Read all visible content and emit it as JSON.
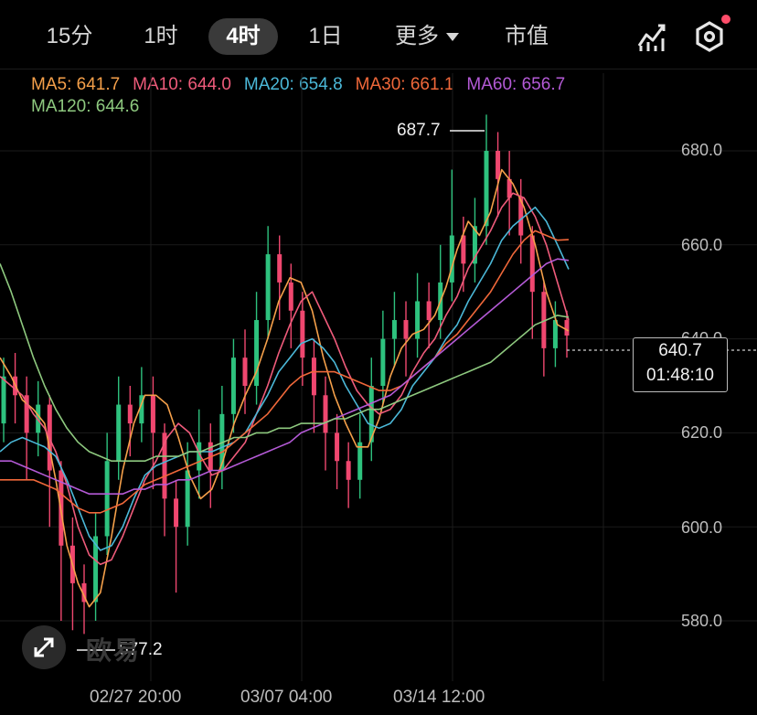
{
  "tabs": [
    {
      "label": "15分"
    },
    {
      "label": "1时"
    },
    {
      "label": "4时"
    },
    {
      "label": "1日"
    },
    {
      "label": "更多"
    },
    {
      "label": "市值"
    }
  ],
  "active_tab": "4时",
  "ma_indicators": [
    {
      "label": "MA5: 641.7",
      "color": "#f5a04a"
    },
    {
      "label": "MA10: 644.0",
      "color": "#ef5b7b"
    },
    {
      "label": "MA20: 654.8",
      "color": "#4bb8d8"
    },
    {
      "label": "MA30: 661.1",
      "color": "#f0683a"
    },
    {
      "label": "MA60: 656.7",
      "color": "#b45ad6"
    },
    {
      "label": "MA120: 644.6",
      "color": "#8ec97f"
    }
  ],
  "current_price": {
    "price": "640.7",
    "countdown": "01:48:10",
    "value": 640.7
  },
  "high_marker": {
    "label": "687.7",
    "value": 687.7
  },
  "low_marker": {
    "label": "577.2",
    "value": 577.2
  },
  "watermark": "欧易",
  "colors": {
    "up": "#2ec27e",
    "down": "#ef476f",
    "grid": "#1b1b1b"
  },
  "chart_data": {
    "type": "candlestick",
    "ylim": [
      570,
      692
    ],
    "y_ticks": [
      580.0,
      600.0,
      620.0,
      640.0,
      660.0,
      680.0
    ],
    "y_tick_labels": [
      "580.0",
      "600.0",
      "620.0",
      "640.0",
      "660.0",
      "680.0"
    ],
    "x_tick_labels": [
      "02/27 20:00",
      "03/07 04:00",
      "03/14 12:00"
    ],
    "series": [
      {
        "name": "MA5",
        "values": [
          636,
          632,
          627,
          625,
          622,
          610,
          596,
          588,
          583,
          586,
          598,
          612,
          622,
          628,
          628,
          626,
          619,
          611,
          606,
          608,
          614,
          622,
          628,
          633,
          640,
          648,
          653,
          652,
          646,
          636,
          628,
          622,
          617,
          617,
          623,
          632,
          638,
          641,
          642,
          645,
          651,
          659,
          665,
          662,
          667,
          676,
          673,
          668,
          660,
          650,
          643,
          641.7
        ]
      },
      {
        "name": "MA10",
        "values": [
          632,
          630,
          628,
          624,
          621,
          616,
          609,
          600,
          594,
          592,
          593,
          598,
          604,
          610,
          614,
          619,
          622,
          620,
          615,
          611,
          612,
          615,
          618,
          624,
          630,
          637,
          643,
          648,
          650,
          645,
          640,
          634,
          629,
          626,
          624,
          625,
          628,
          633,
          637,
          640,
          645,
          649,
          655,
          659,
          663,
          668,
          671,
          670,
          666,
          660,
          652,
          644.0
        ]
      },
      {
        "name": "MA20",
        "values": [
          616,
          618,
          619,
          618,
          617,
          615,
          610,
          604,
          598,
          595,
          596,
          600,
          606,
          611,
          613,
          614,
          615,
          616,
          616,
          616,
          617,
          618,
          620,
          624,
          628,
          633,
          636,
          639,
          640,
          638,
          635,
          630,
          626,
          622,
          621,
          622,
          625,
          630,
          633,
          636,
          640,
          643,
          648,
          652,
          656,
          661,
          664,
          666,
          668,
          665,
          660,
          654.8
        ]
      },
      {
        "name": "MA30",
        "values": [
          610,
          610,
          610,
          610,
          609,
          608,
          606,
          604,
          603,
          603,
          604,
          605,
          607,
          609,
          610,
          611,
          612,
          613,
          614,
          615,
          616,
          618,
          620,
          622,
          624,
          627,
          630,
          632,
          633,
          633,
          633,
          632,
          631,
          630,
          629,
          629,
          630,
          632,
          634,
          636,
          639,
          641,
          644,
          647,
          650,
          654,
          658,
          661,
          663,
          662,
          661,
          661.1
        ]
      },
      {
        "name": "MA60",
        "values": [
          614,
          614,
          613,
          612,
          611,
          610,
          609,
          608,
          607,
          607,
          607,
          607,
          608,
          608,
          609,
          609,
          610,
          610,
          611,
          612,
          612,
          613,
          614,
          615,
          616,
          617,
          618,
          620,
          621,
          622,
          623,
          624,
          625,
          626,
          627,
          628,
          630,
          632,
          634,
          636,
          638,
          640,
          642,
          644,
          646,
          648,
          650,
          652,
          654,
          656,
          657,
          656.7
        ]
      },
      {
        "name": "MA120",
        "values": [
          656,
          650,
          643,
          636,
          630,
          625,
          621,
          618,
          616,
          615,
          614,
          614,
          614,
          614,
          615,
          615,
          615,
          616,
          616,
          617,
          618,
          619,
          619,
          620,
          620,
          621,
          621,
          622,
          622,
          622,
          623,
          623,
          624,
          625,
          625,
          626,
          627,
          628,
          629,
          630,
          631,
          632,
          633,
          634,
          635,
          637,
          639,
          641,
          643,
          644,
          645,
          644.6
        ]
      }
    ],
    "candles": [
      {
        "o": 622,
        "c": 632,
        "h": 636,
        "l": 618
      },
      {
        "o": 632,
        "c": 628,
        "h": 637,
        "l": 622
      },
      {
        "o": 628,
        "c": 620,
        "h": 632,
        "l": 610
      },
      {
        "o": 620,
        "c": 626,
        "h": 631,
        "l": 615
      },
      {
        "o": 626,
        "c": 612,
        "h": 628,
        "l": 600
      },
      {
        "o": 612,
        "c": 596,
        "h": 614,
        "l": 580
      },
      {
        "o": 596,
        "c": 588,
        "h": 602,
        "l": 578
      },
      {
        "o": 588,
        "c": 584,
        "h": 592,
        "l": 577.2
      },
      {
        "o": 584,
        "c": 598,
        "h": 603,
        "l": 580
      },
      {
        "o": 598,
        "c": 614,
        "h": 620,
        "l": 594
      },
      {
        "o": 614,
        "c": 626,
        "h": 632,
        "l": 610
      },
      {
        "o": 626,
        "c": 622,
        "h": 630,
        "l": 615
      },
      {
        "o": 622,
        "c": 628,
        "h": 634,
        "l": 618
      },
      {
        "o": 628,
        "c": 620,
        "h": 632,
        "l": 608
      },
      {
        "o": 620,
        "c": 606,
        "h": 622,
        "l": 598
      },
      {
        "o": 606,
        "c": 600,
        "h": 610,
        "l": 586
      },
      {
        "o": 600,
        "c": 612,
        "h": 618,
        "l": 596
      },
      {
        "o": 612,
        "c": 618,
        "h": 625,
        "l": 606
      },
      {
        "o": 618,
        "c": 612,
        "h": 622,
        "l": 604
      },
      {
        "o": 612,
        "c": 624,
        "h": 630,
        "l": 608
      },
      {
        "o": 624,
        "c": 636,
        "h": 640,
        "l": 620
      },
      {
        "o": 636,
        "c": 630,
        "h": 642,
        "l": 624
      },
      {
        "o": 630,
        "c": 644,
        "h": 650,
        "l": 626
      },
      {
        "o": 644,
        "c": 658,
        "h": 664,
        "l": 640
      },
      {
        "o": 658,
        "c": 652,
        "h": 662,
        "l": 644
      },
      {
        "o": 652,
        "c": 646,
        "h": 656,
        "l": 638
      },
      {
        "o": 646,
        "c": 636,
        "h": 650,
        "l": 630
      },
      {
        "o": 636,
        "c": 628,
        "h": 640,
        "l": 620
      },
      {
        "o": 628,
        "c": 620,
        "h": 632,
        "l": 612
      },
      {
        "o": 620,
        "c": 614,
        "h": 624,
        "l": 608
      },
      {
        "o": 614,
        "c": 610,
        "h": 618,
        "l": 604
      },
      {
        "o": 610,
        "c": 618,
        "h": 624,
        "l": 606
      },
      {
        "o": 618,
        "c": 630,
        "h": 636,
        "l": 614
      },
      {
        "o": 630,
        "c": 640,
        "h": 646,
        "l": 626
      },
      {
        "o": 640,
        "c": 644,
        "h": 650,
        "l": 634
      },
      {
        "o": 644,
        "c": 640,
        "h": 648,
        "l": 632
      },
      {
        "o": 640,
        "c": 648,
        "h": 654,
        "l": 636
      },
      {
        "o": 648,
        "c": 644,
        "h": 652,
        "l": 638
      },
      {
        "o": 644,
        "c": 652,
        "h": 660,
        "l": 640
      },
      {
        "o": 652,
        "c": 662,
        "h": 676,
        "l": 648
      },
      {
        "o": 662,
        "c": 656,
        "h": 666,
        "l": 650
      },
      {
        "o": 656,
        "c": 664,
        "h": 670,
        "l": 652
      },
      {
        "o": 664,
        "c": 680,
        "h": 687.7,
        "l": 660
      },
      {
        "o": 680,
        "c": 674,
        "h": 684,
        "l": 666
      },
      {
        "o": 674,
        "c": 670,
        "h": 680,
        "l": 662
      },
      {
        "o": 670,
        "c": 662,
        "h": 674,
        "l": 656
      },
      {
        "o": 662,
        "c": 650,
        "h": 664,
        "l": 640
      },
      {
        "o": 650,
        "c": 638,
        "h": 652,
        "l": 632
      },
      {
        "o": 638,
        "c": 644,
        "h": 648,
        "l": 634
      },
      {
        "o": 644,
        "c": 640.7,
        "h": 646,
        "l": 636
      }
    ]
  }
}
